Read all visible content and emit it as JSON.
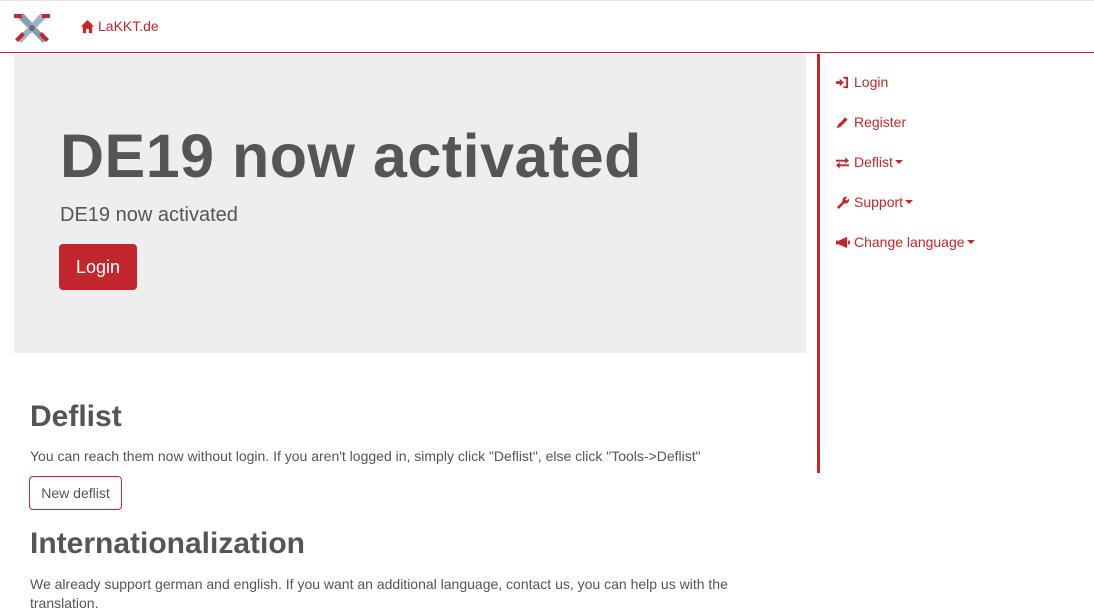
{
  "navbar": {
    "logo_icon": "crossed-swords-logo-icon",
    "brand_icon": "home-icon",
    "brand_label": "LaKKT.de"
  },
  "hero": {
    "title": "DE19 now activated",
    "subtitle": "DE19 now activated",
    "login_button": "Login"
  },
  "sidebar": {
    "items": [
      {
        "icon": "login-icon",
        "label": "Login",
        "dropdown": false
      },
      {
        "icon": "pencil-icon",
        "label": "Register",
        "dropdown": false
      },
      {
        "icon": "swap-arrows-icon",
        "label": "Deflist",
        "dropdown": true
      },
      {
        "icon": "wrench-icon",
        "label": "Support",
        "dropdown": true
      },
      {
        "icon": "megaphone-icon",
        "label": "Change language",
        "dropdown": true
      }
    ]
  },
  "sections": {
    "deflist": {
      "heading": "Deflist",
      "text": "You can reach them now without login. If you aren't logged in, simply click \"Deflist\", else click \"Tools->Deflist\"",
      "button": "New deflist"
    },
    "i18n": {
      "heading": "Internationalization",
      "text": "We already support german and english. If you want an additional language, contact us, you can help us with the translation."
    }
  },
  "colors": {
    "accent": "#c1272d",
    "hero_bg": "#eeeeee",
    "text": "#555555"
  }
}
